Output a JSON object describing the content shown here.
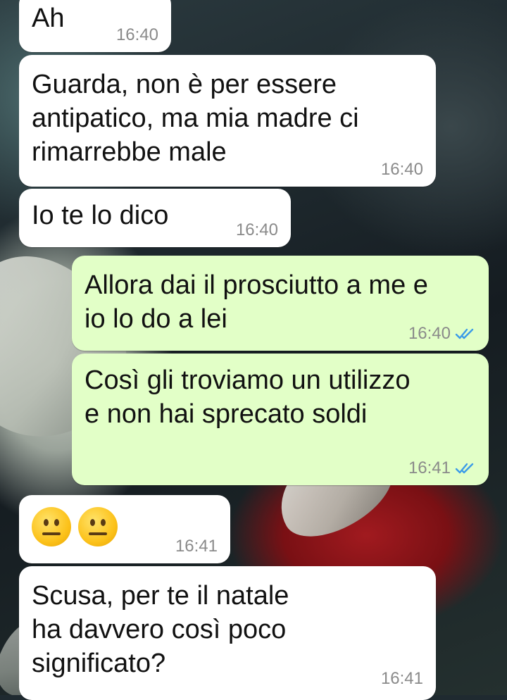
{
  "messages": [
    {
      "direction": "incoming",
      "text": "Ah",
      "time": "16:40"
    },
    {
      "direction": "incoming",
      "text": "Guarda, non è per essere\nantipatico, ma mia madre ci\nrimarrebbe male",
      "time": "16:40"
    },
    {
      "direction": "incoming",
      "text": "Io te lo dico",
      "time": "16:40"
    },
    {
      "direction": "outgoing",
      "text": "Allora dai il prosciutto a me e\nio lo do a lei",
      "time": "16:40",
      "status": "read-ticks-icon"
    },
    {
      "direction": "outgoing",
      "text": "Così gli troviamo un utilizzo\ne non hai sprecato soldi",
      "time": "16:41",
      "status": "read-ticks-icon"
    },
    {
      "direction": "incoming",
      "emoji": [
        "neutral-face-emoji",
        "neutral-face-emoji"
      ],
      "time": "16:41"
    },
    {
      "direction": "incoming",
      "text": "Scusa, per te il natale\nha davvero così poco\nsignificato?",
      "time": "16:41"
    }
  ],
  "colors": {
    "incoming_bubble": "#ffffff",
    "outgoing_bubble": "#e2ffc7",
    "timestamp": "#8a8a8a",
    "read_ticks": "#3b9be8"
  }
}
